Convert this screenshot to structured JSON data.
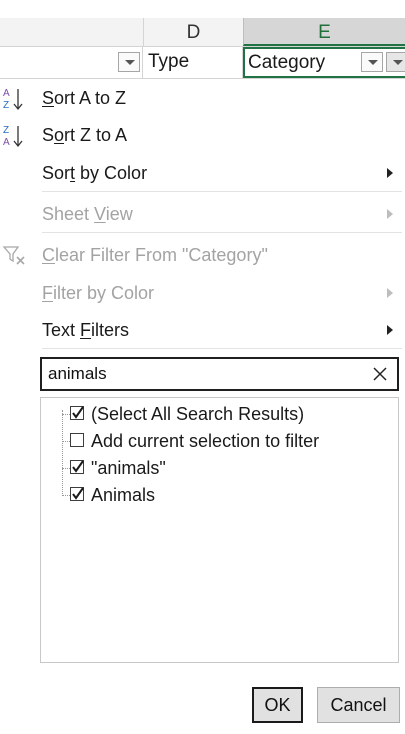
{
  "sheet": {
    "columns": [
      {
        "letter": "D",
        "field": "Type"
      },
      {
        "letter": "E",
        "field": "Category"
      }
    ]
  },
  "menu": {
    "sort_az": {
      "pre": "",
      "ul": "S",
      "post": "ort A to Z",
      "icon": "sort-a-to-z-icon"
    },
    "sort_za": {
      "pre": "S",
      "ul": "o",
      "post": "rt Z to A",
      "icon": "sort-z-to-a-icon"
    },
    "sort_color": {
      "pre": "Sor",
      "ul": "t",
      "post": " by Color",
      "submenu": true
    },
    "sheet_view": {
      "pre": "Sheet ",
      "ul": "V",
      "post": "iew",
      "disabled": true,
      "submenu": true
    },
    "clear_filter": {
      "pre": "",
      "ul": "C",
      "post": "lear Filter From \"Category\"",
      "disabled": true,
      "icon": "clear-filter-icon"
    },
    "filter_color": {
      "pre": "",
      "ul": "F",
      "post": "ilter by Color",
      "disabled": true,
      "submenu": true
    },
    "text_filters": {
      "pre": "Text ",
      "ul": "F",
      "post": "ilters",
      "submenu": true
    }
  },
  "search": {
    "value": "animals",
    "clear_icon": "close-icon"
  },
  "values": [
    {
      "label": "(Select All Search Results)",
      "checked": true
    },
    {
      "label": "Add current selection to filter",
      "checked": false
    },
    {
      "label": "\"animals\"",
      "checked": true
    },
    {
      "label": "Animals",
      "checked": true
    }
  ],
  "buttons": {
    "ok": "OK",
    "cancel": "Cancel"
  },
  "colors": {
    "excel_green": "#217346",
    "disabled_text": "#a3a3a3",
    "sort_icon_blue": "#2b6cc4"
  }
}
